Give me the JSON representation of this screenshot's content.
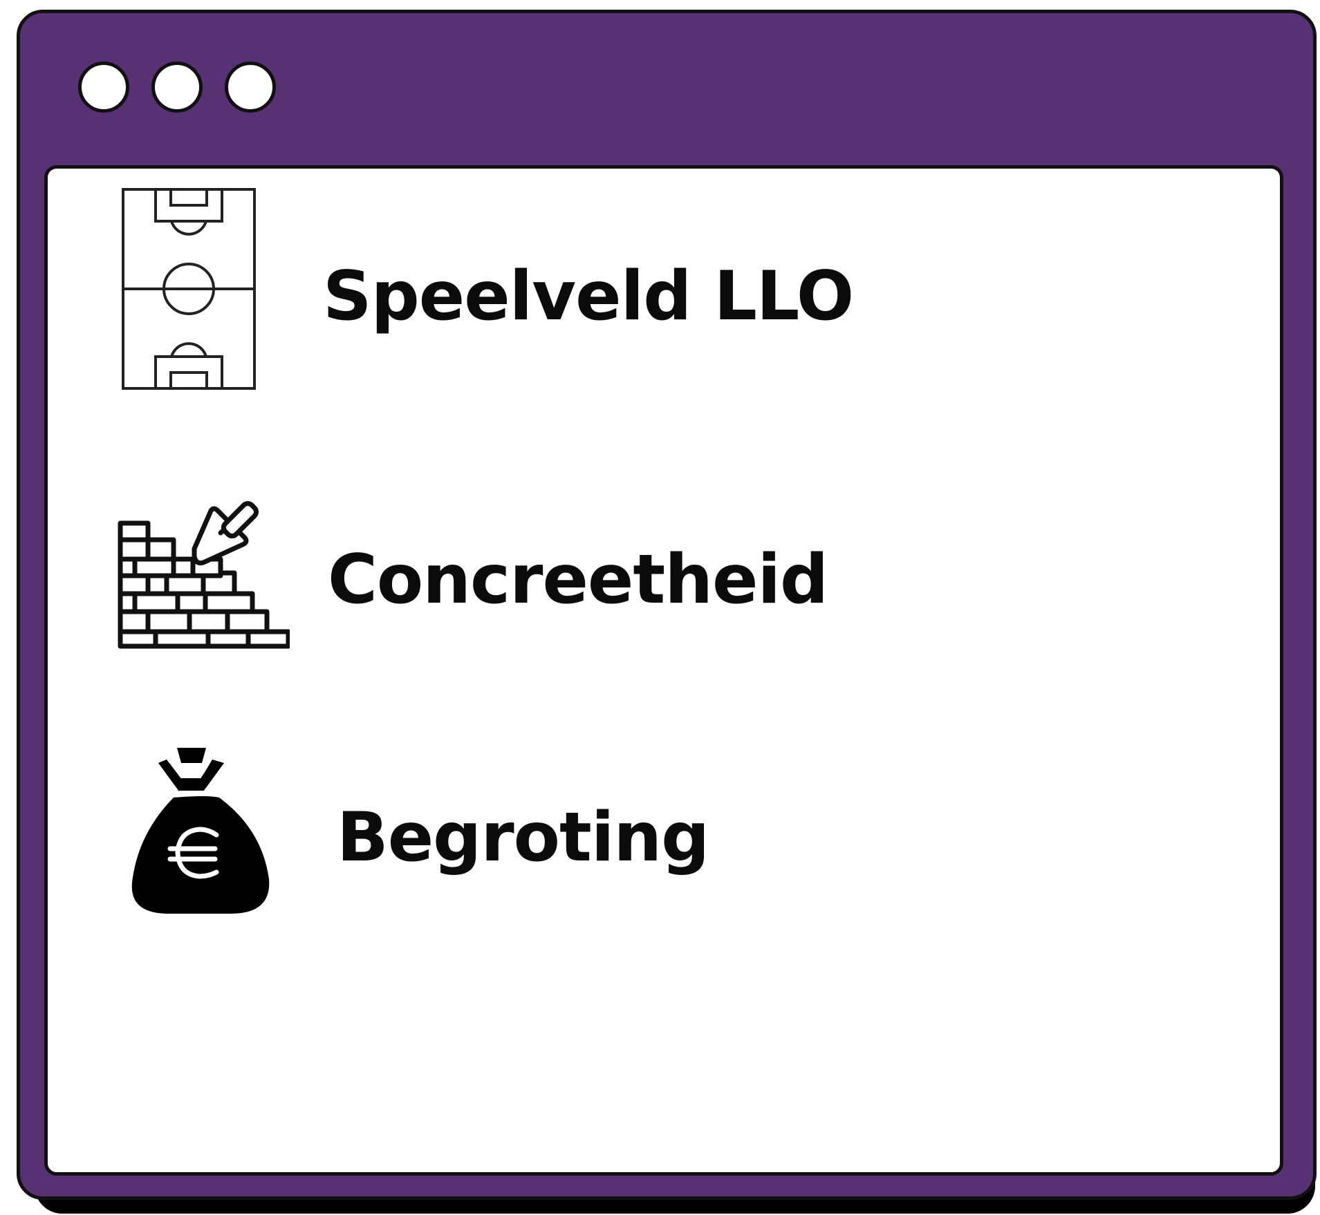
{
  "window": {
    "controls": [
      "dot",
      "dot",
      "dot"
    ]
  },
  "items": [
    {
      "label": "Speelveld LLO",
      "icon": "soccer-field-icon"
    },
    {
      "label": "Concreetheid",
      "icon": "brick-wall-trowel-icon"
    },
    {
      "label": "Begroting",
      "icon": "euro-money-bag-icon"
    }
  ],
  "colors": {
    "frame": "#573173",
    "panel": "#ffffff",
    "text": "#0b0b0b"
  }
}
